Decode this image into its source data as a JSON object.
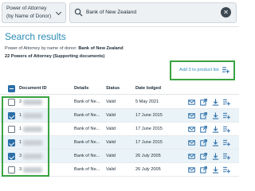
{
  "search": {
    "filter_value": "Power of Attorney (by Name of Donor)",
    "query": "Bank of New Zealand",
    "clear_label": "✕"
  },
  "results": {
    "title": "Search results",
    "summary_prefix": "Power of Attorney by name of donor:",
    "summary_name": "Bank of New Zealand",
    "count_text": "22 Powers of Attorney (Supporting documents)",
    "add_label": "Add 3 to product list"
  },
  "table": {
    "columns": [
      "Document ID",
      "Details",
      "Status",
      "Date lodged"
    ],
    "rows": [
      {
        "id_prefix": "2",
        "details": "Bank of Ne...",
        "status": "Valid",
        "date": "5 May 2021",
        "selected": false
      },
      {
        "id_prefix": "1",
        "details": "Bank of Ne...",
        "status": "Valid",
        "date": "17 June 2015",
        "selected": true
      },
      {
        "id_prefix": "1",
        "details": "Bank of Ne...",
        "status": "Valid",
        "date": "17 June 2015",
        "selected": false
      },
      {
        "id_prefix": "1",
        "details": "Bank of Ne...",
        "status": "Valid",
        "date": "17 June 2015",
        "selected": true
      },
      {
        "id_prefix": "3",
        "details": "Bank of Ne...",
        "status": "Valid",
        "date": "26 July 2005",
        "selected": true
      },
      {
        "id_prefix": "3",
        "details": "Bank of Ne...",
        "status": "Valid",
        "date": "26 July 2005",
        "selected": false
      }
    ],
    "row_icons": [
      "envelope-icon",
      "external-link-icon",
      "download-icon",
      "add-to-list-icon"
    ]
  },
  "colors": {
    "accent": "#2b8bb6",
    "checkbox": "#2b6ea8",
    "highlight": "#3aa342",
    "selected_row": "#eaf3f8"
  }
}
